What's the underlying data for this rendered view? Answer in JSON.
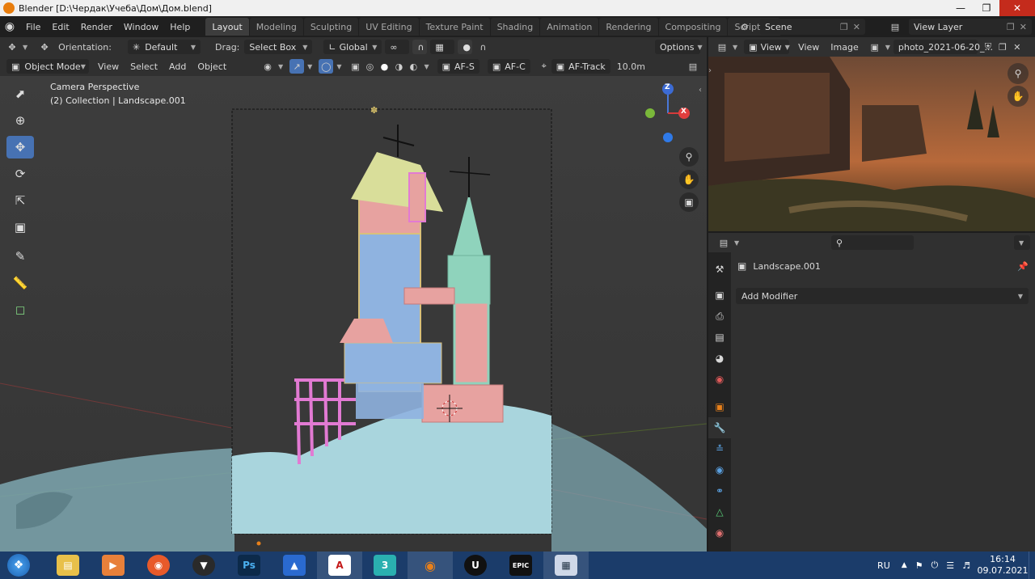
{
  "window": {
    "title": "Blender [D:\\Чердак\\Учеба\\Дом\\Дом.blend]"
  },
  "menu": [
    "File",
    "Edit",
    "Render",
    "Window",
    "Help"
  ],
  "workspaces": [
    "Layout",
    "Modeling",
    "Sculpting",
    "UV Editing",
    "Texture Paint",
    "Shading",
    "Animation",
    "Rendering",
    "Compositing",
    "Scripting"
  ],
  "active_workspace": "Layout",
  "scene": {
    "name": "Scene",
    "view_layer": "View Layer"
  },
  "tool_header": {
    "orientation_label": "Orientation:",
    "orientation_value": "Default",
    "drag_label": "Drag:",
    "drag_value": "Select Box",
    "transform_orientation": "Global",
    "options_label": "Options"
  },
  "viewport_header": {
    "mode": "Object Mode",
    "menus": [
      "View",
      "Select",
      "Add",
      "Object"
    ],
    "af_s": "AF-S",
    "af_c": "AF-C",
    "af_track": "AF-Track",
    "distance": "10.0m"
  },
  "viewport": {
    "camera_label": "Camera Perspective",
    "collection_label": "(2) Collection | Landscape.001"
  },
  "gizmo": {
    "z": "Z",
    "x": "X"
  },
  "image_editor": {
    "view": "View",
    "view_menu": "View",
    "image_menu": "Image",
    "image_name": "photo_2021-06-20_..."
  },
  "properties": {
    "object_name": "Landscape.001",
    "add_modifier": "Add Modifier"
  },
  "taskbar": {
    "apps": [
      "explorer",
      "media-player",
      "firefox",
      "inkscape",
      "photoshop",
      "affinity",
      "autocad",
      "3ds-max",
      "blender",
      "unreal-engine",
      "epic-games",
      "calculator"
    ],
    "ps_label": "Ps",
    "max_label": "3",
    "epic_label": "EPIC",
    "lang": "RU",
    "time": "16:14",
    "date": "09.07.2021"
  },
  "colors": {
    "accent": "#4772b3",
    "snow": "#a9d5dd",
    "tower_blue": "#8fb3e0",
    "tower_pink": "#e7a2a0",
    "tower_mint": "#8fd3bc",
    "roof_yellow": "#d9de9a",
    "magenta": "#e27ad3"
  }
}
